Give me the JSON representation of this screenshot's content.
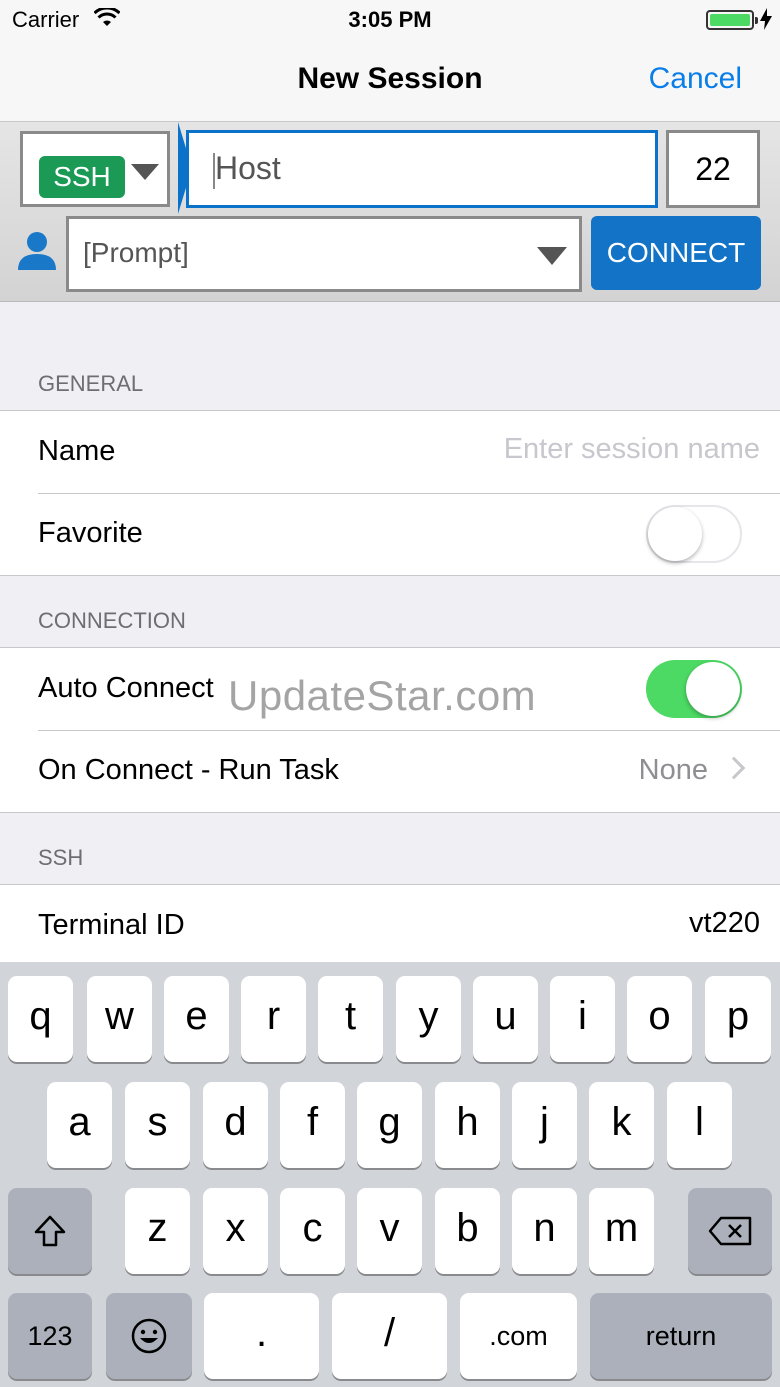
{
  "status_bar": {
    "carrier": "Carrier",
    "time": "3:05 PM"
  },
  "nav": {
    "title": "New Session",
    "cancel": "Cancel"
  },
  "connection": {
    "protocol": "SSH",
    "host_placeholder": "Host",
    "port": "22",
    "credentials": "[Prompt]",
    "connect_label": "CONNECT"
  },
  "sections": {
    "general": {
      "header": "GENERAL",
      "name_label": "Name",
      "name_placeholder": "Enter session name",
      "favorite_label": "Favorite",
      "favorite_on": false
    },
    "connection": {
      "header": "CONNECTION",
      "auto_connect_label": "Auto Connect",
      "auto_connect_on": true,
      "on_connect_label": "On Connect - Run Task",
      "on_connect_value": "None"
    },
    "ssh": {
      "header": "SSH",
      "terminal_id_label": "Terminal ID",
      "terminal_id_value": "vt220"
    }
  },
  "watermark": "UpdateStar.com",
  "keyboard": {
    "row1": [
      "q",
      "w",
      "e",
      "r",
      "t",
      "y",
      "u",
      "i",
      "o",
      "p"
    ],
    "row2": [
      "a",
      "s",
      "d",
      "f",
      "g",
      "h",
      "j",
      "k",
      "l"
    ],
    "row3": [
      "z",
      "x",
      "c",
      "v",
      "b",
      "n",
      "m"
    ],
    "numbers_key": "123",
    "period_key": ".",
    "slash_key": "/",
    "dotcom_key": ".com",
    "return_key": "return"
  },
  "colors": {
    "accent": "#0a7ee8",
    "ssh_badge": "#1a9a55",
    "switch_on": "#4cd964",
    "connect_button": "#1273c7"
  },
  "icons": [
    "wifi-icon",
    "battery-icon",
    "charging-bolt-icon",
    "user-icon",
    "dropdown-caret-icon",
    "chevron-right-icon",
    "shift-icon",
    "backspace-icon",
    "emoji-icon"
  ]
}
